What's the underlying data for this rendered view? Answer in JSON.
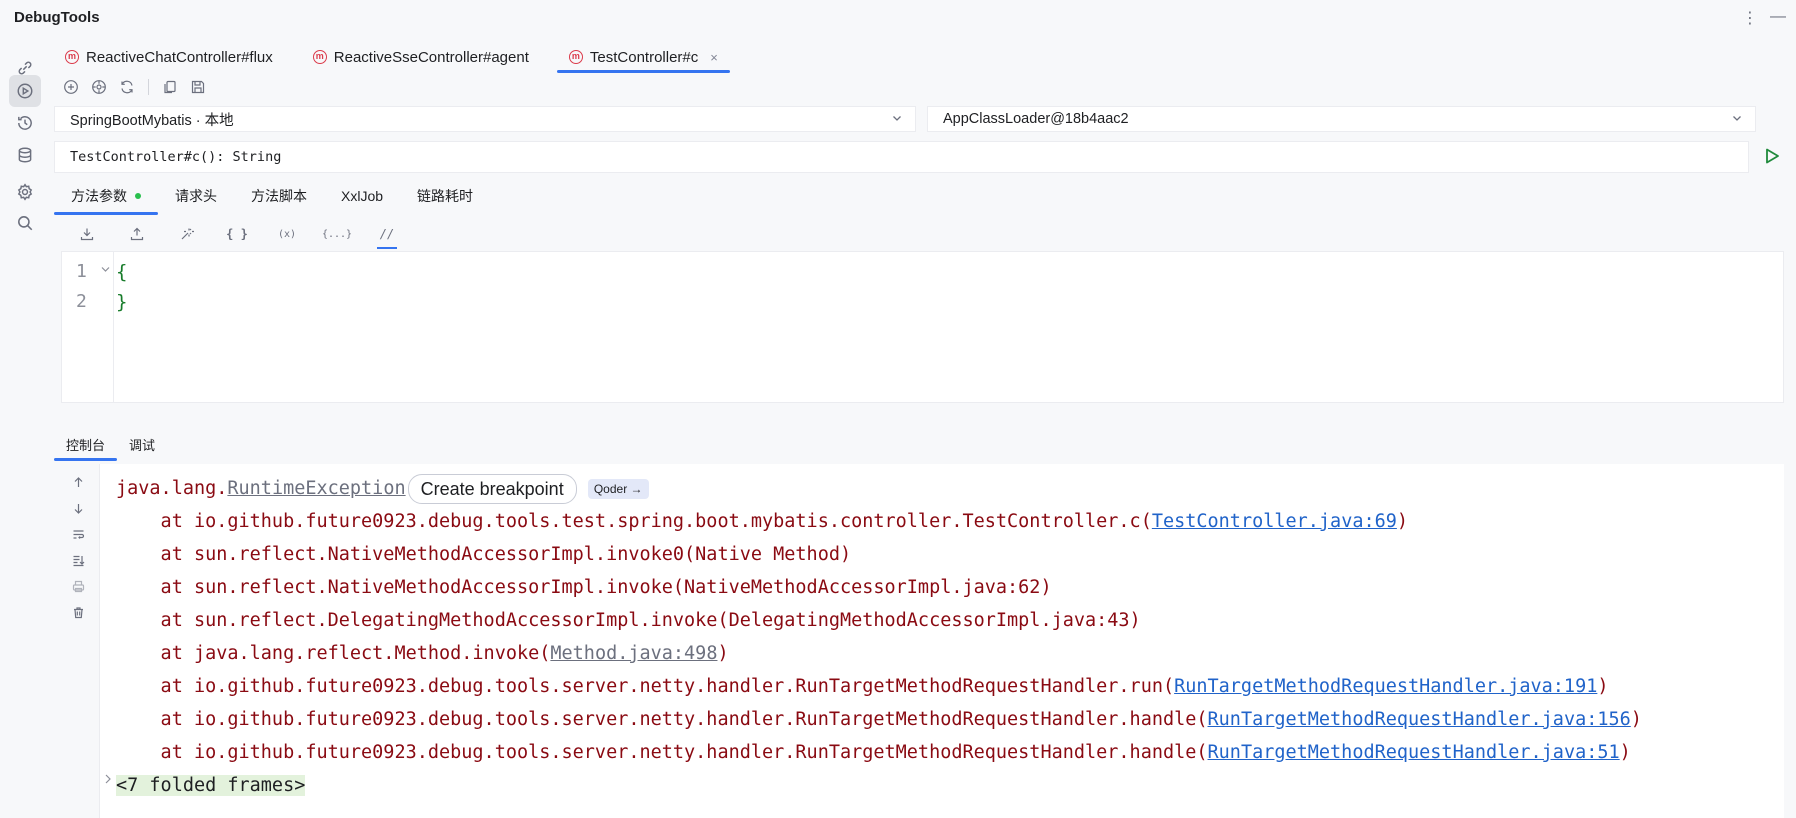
{
  "app_title": "DebugTools",
  "title_actions": {
    "more": "⋮",
    "minimize": "—"
  },
  "tabs": [
    {
      "label": "ReactiveChatController#flux",
      "active": false
    },
    {
      "label": "ReactiveSseController#agent",
      "active": false
    },
    {
      "label": "TestController#c",
      "active": true
    }
  ],
  "tab_icon_letter": "m",
  "tab_close": "×",
  "selectors": {
    "project": "SpringBootMybatis · 本地",
    "classloader": "AppClassLoader@18b4aac2"
  },
  "method_signature": "TestController#c(): String",
  "subtabs": [
    {
      "label": "方法参数",
      "active": true,
      "dot": true
    },
    {
      "label": "请求头"
    },
    {
      "label": "方法脚本"
    },
    {
      "label": "XxlJob"
    },
    {
      "label": "链路耗时"
    }
  ],
  "editor_toolbar": [
    "import-icon",
    "export-icon",
    "magic-icon",
    "{ }",
    "(x)",
    "{...}",
    "//"
  ],
  "editor": {
    "line_numbers": [
      "1",
      "2"
    ],
    "lines": [
      "{",
      "}"
    ]
  },
  "console_tabs": [
    {
      "label": "控制台",
      "active": true
    },
    {
      "label": "调试"
    }
  ],
  "console": {
    "exception_prefix": "java.lang.",
    "exception_name": "RuntimeException",
    "create_breakpoint": "Create breakpoint",
    "qoder": "Qoder →",
    "frames": [
      {
        "text": "    at io.github.future0923.debug.tools.test.spring.boot.mybatis.controller.TestController.c(",
        "link": "TestController.java:69",
        "suffix": ")",
        "link_style": "blue"
      },
      {
        "text": "    at sun.reflect.NativeMethodAccessorImpl.invoke0(Native Method)",
        "link": "",
        "suffix": ""
      },
      {
        "text": "    at sun.reflect.NativeMethodAccessorImpl.invoke(NativeMethodAccessorImpl.java:62)",
        "link": "",
        "suffix": ""
      },
      {
        "text": "    at sun.reflect.DelegatingMethodAccessorImpl.invoke(DelegatingMethodAccessorImpl.java:43)",
        "link": "",
        "suffix": ""
      },
      {
        "text": "    at java.lang.reflect.Method.invoke(",
        "link": "Method.java:498",
        "suffix": ")",
        "link_style": "grey"
      },
      {
        "text": "    at io.github.future0923.debug.tools.server.netty.handler.RunTargetMethodRequestHandler.run(",
        "link": "RunTargetMethodRequestHandler.java:191",
        "suffix": ")",
        "link_style": "blue"
      },
      {
        "text": "    at io.github.future0923.debug.tools.server.netty.handler.RunTargetMethodRequestHandler.handle(",
        "link": "RunTargetMethodRequestHandler.java:156",
        "suffix": ")",
        "link_style": "blue"
      },
      {
        "text": "    at io.github.future0923.debug.tools.server.netty.handler.RunTargetMethodRequestHandler.handle(",
        "link": "RunTargetMethodRequestHandler.java:51",
        "suffix": ")",
        "link_style": "blue"
      }
    ],
    "folded": "<7 folded frames>"
  },
  "colors": {
    "accent": "#3574f0",
    "error_text": "#8a0a12",
    "link": "#2063c9",
    "run_green": "#208a3c",
    "modified_dot": "#29c04d"
  }
}
